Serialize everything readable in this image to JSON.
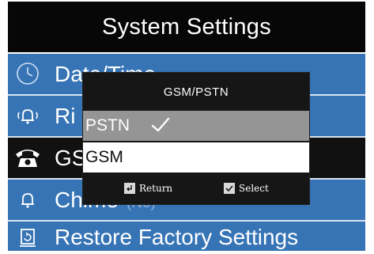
{
  "header": {
    "title": "System Settings"
  },
  "menu": {
    "items": [
      {
        "label": "Date/Time",
        "suffix": "",
        "icon": "clock-icon"
      },
      {
        "label": "Ri",
        "suffix": "",
        "icon": "bell-ringing-icon"
      },
      {
        "label": "GS",
        "suffix": ")",
        "icon": "telephone-icon"
      },
      {
        "label": "Chime",
        "suffix": "(No)",
        "icon": "bell-icon"
      },
      {
        "label": "Restore Factory Settings",
        "suffix": "",
        "icon": "restore-icon"
      }
    ],
    "selected_index": 2
  },
  "dialog": {
    "title": "GSM/PSTN",
    "options": [
      {
        "label": "PSTN",
        "checked": true
      },
      {
        "label": "GSM",
        "checked": false
      }
    ],
    "footer": {
      "return_label": "Return",
      "select_label": "Select"
    }
  },
  "colors": {
    "title_bar": "#070707",
    "menu_item": "#3674b5",
    "menu_selected": "#111111",
    "dialog_bg": "#161616",
    "option_highlight": "#959595"
  }
}
